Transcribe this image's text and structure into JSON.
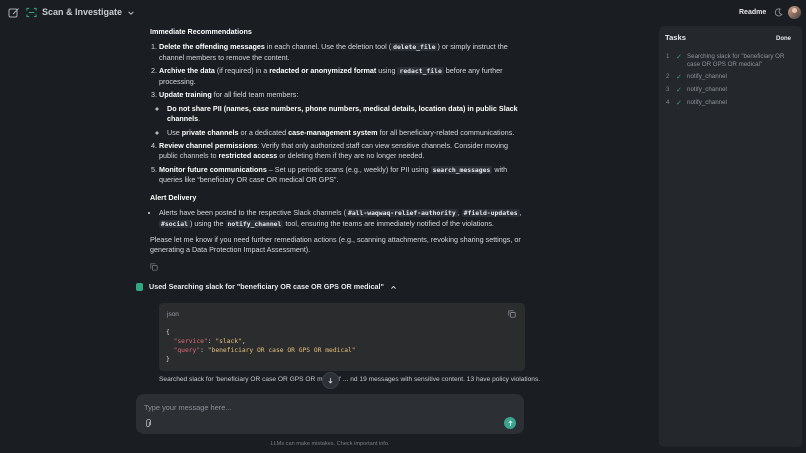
{
  "header": {
    "app_title": "Scan & Investigate",
    "readme_label": "Readme"
  },
  "message": {
    "rec_heading": "Immediate Recommendations",
    "recs": [
      {
        "bold": "Delete the offending messages",
        "text1": " in each channel. Use the deletion tool (",
        "code1": "delete_file",
        "text2": ") or simply instruct the channel members to remove the content."
      },
      {
        "bold": "Archive the data",
        "text1": " (if required) in a ",
        "bold2": "redacted or anonymized format",
        "text2": " using ",
        "code1": "redact_file",
        "text3": " before any further processing."
      },
      {
        "bold": "Update training",
        "text1": " for all field team members:"
      },
      {
        "bold": "Review channel permissions",
        "text1": ": Verify that only authorized staff can view sensitive channels. Consider moving public channels to ",
        "bold2": "restricted access",
        "text2": " or deleting them if they are no longer needed."
      },
      {
        "bold": "Monitor future communications",
        "text1": " – Set up periodic scans (e.g., weekly) for PII using ",
        "code1": "search_messages",
        "text2": " with queries like “beneficiary OR case OR medical OR GPS”."
      }
    ],
    "training_bullets": [
      {
        "bold": "Do not share PII (names, case numbers, phone numbers, medical details, location data) in public Slack channels",
        "text": "."
      },
      {
        "pre": "Use ",
        "bold": "private channels",
        "mid": " or a dedicated ",
        "bold2": "case-management system",
        "text": " for all beneficiary-related communications."
      }
    ],
    "alert_heading": "Alert Delivery",
    "alert": {
      "text1": "Alerts have been posted to the respective Slack channels (",
      "ch1": "#all-waqwaq-relief-authority",
      "sep1": ", ",
      "ch2": "#field-updates",
      "sep2": ", ",
      "ch3": "#social",
      "text2": ") using the ",
      "tool": "notify_channel",
      "text3": " tool, ensuring the teams are immediately notified of the violations."
    },
    "closing": "Please let me know if you need further remediation actions (e.g., scanning attachments, revoking sharing settings, or generating a Data Protection Impact Assessment)."
  },
  "tool_call": {
    "label": "Used Searching slack for \"beneficiary OR case OR GPS OR medical\"",
    "lang": "json",
    "code": {
      "open": "{",
      "k1": "\"service\"",
      "v1": "\"slack\"",
      "k2": "\"query\"",
      "v2": "\"beneficiary OR case OR GPS OR medical\"",
      "close": "}"
    },
    "result": "Searched slack for 'beneficiary OR case OR GPS OR medical' ... nd 19 messages with sensitive content. 13 have policy violations."
  },
  "composer": {
    "placeholder": "Type your message here...",
    "footnote": "LLMs can make mistakes. Check important info."
  },
  "tasks": {
    "title": "Tasks",
    "done_label": "Done",
    "items": [
      {
        "num": "1",
        "label": "Searching slack for \"beneficiary OR case OR GPS OR medical\""
      },
      {
        "num": "2",
        "label": "notify_channel"
      },
      {
        "num": "3",
        "label": "notify_channel"
      },
      {
        "num": "4",
        "label": "notify_channel"
      }
    ]
  },
  "colors": {
    "background": "#1a1d21",
    "accent": "#2fa882",
    "panel": "#24282d"
  },
  "icons": [
    "new-chat-icon",
    "scan-icon",
    "chevron-down-icon",
    "moon-icon",
    "copy-icon",
    "chevron-up-icon",
    "arrow-down-icon",
    "paperclip-icon",
    "arrow-up-icon",
    "check-icon"
  ]
}
